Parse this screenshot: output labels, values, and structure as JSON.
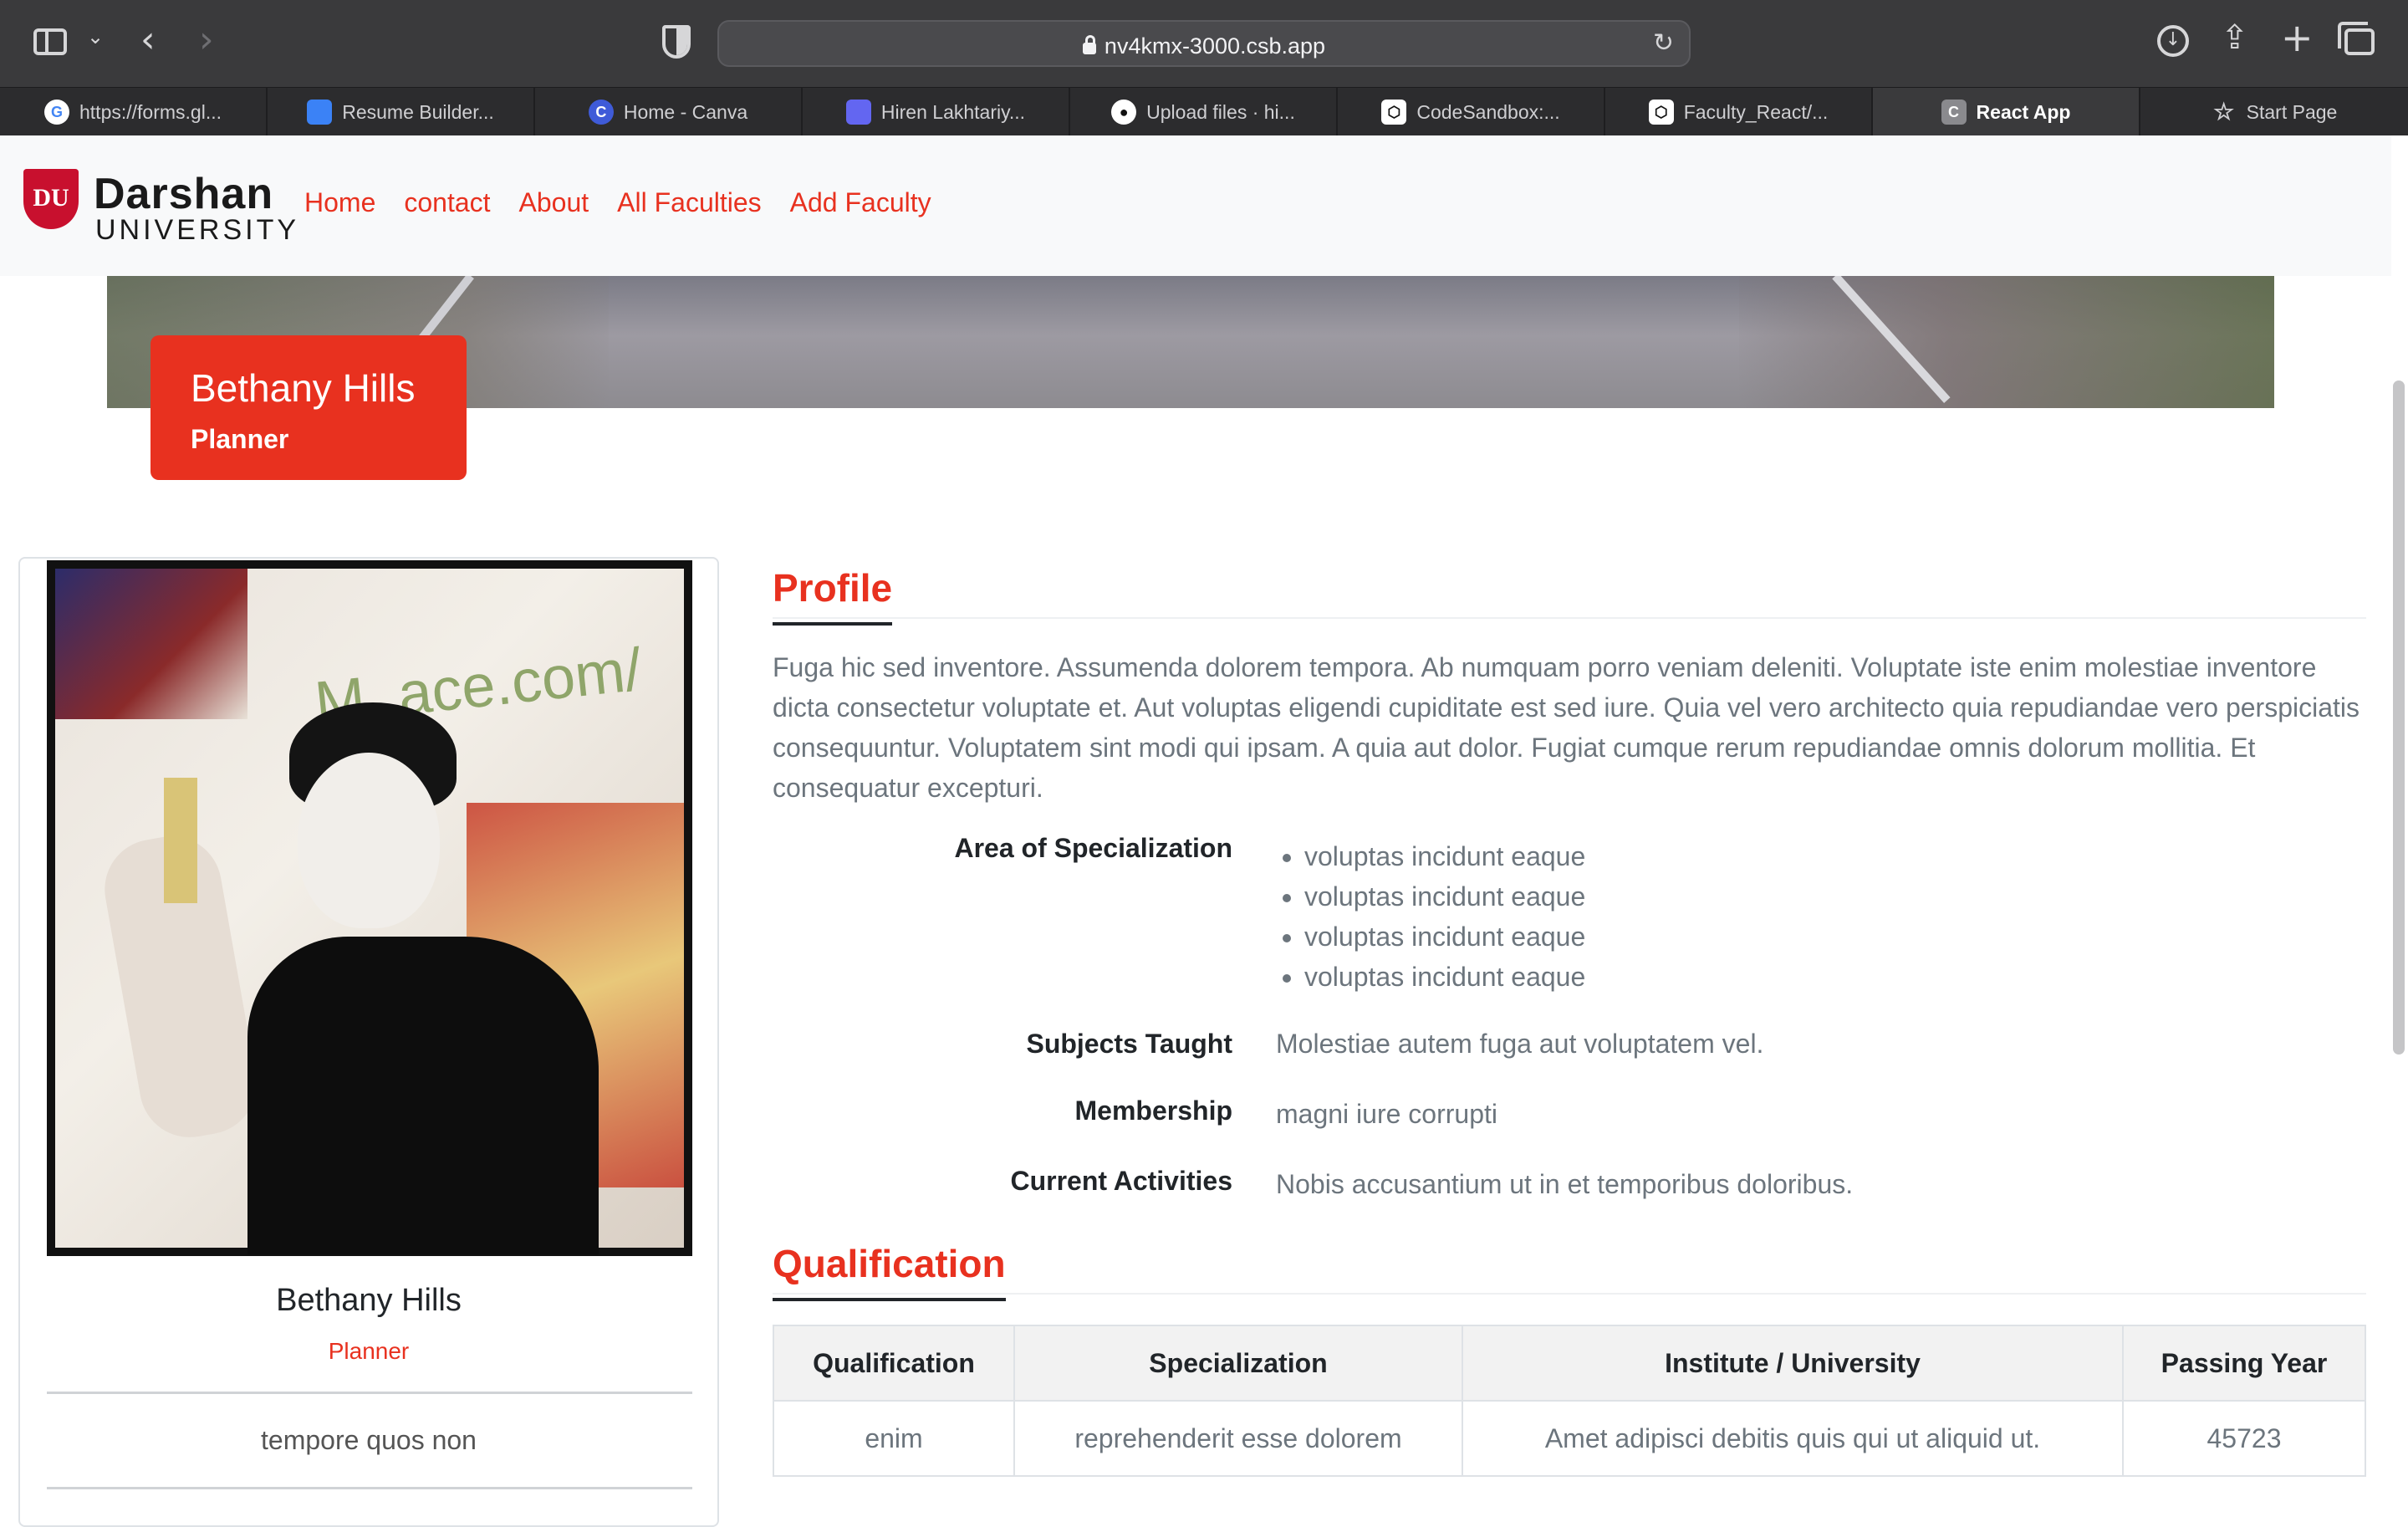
{
  "browser": {
    "url": "nv4kmx-3000.csb.app",
    "tabs": [
      {
        "label": "https://forms.gl...",
        "icon": "google-icon",
        "color": "#ffffff"
      },
      {
        "label": "Resume Builder...",
        "icon": "resume-icon",
        "color": "#3b82f6"
      },
      {
        "label": "Home - Canva",
        "icon": "canva-icon",
        "color": "#3f5bd8"
      },
      {
        "label": "Hiren Lakhtariy...",
        "icon": "profile-icon",
        "color": "#6366f1"
      },
      {
        "label": "Upload files · hi...",
        "icon": "github-icon",
        "color": "#ffffff"
      },
      {
        "label": "CodeSandbox:...",
        "icon": "codesandbox-icon",
        "color": "#ffffff"
      },
      {
        "label": "Faculty_React/...",
        "icon": "codesandbox-icon",
        "color": "#ffffff"
      },
      {
        "label": "React App",
        "icon": "react-app-icon",
        "color": "#8a8a8e",
        "active": true
      },
      {
        "label": "Start Page",
        "icon": "star-icon",
        "color": "#cfcfd2"
      }
    ]
  },
  "navbar": {
    "logo_name": "Darshan",
    "logo_sub": "UNIVERSITY",
    "logo_mark": "DU",
    "links": [
      "Home",
      "contact",
      "About",
      "All Faculties",
      "Add Faculty"
    ]
  },
  "hero": {
    "name": "Bethany Hills",
    "role": "Planner"
  },
  "card": {
    "name": "Bethany Hills",
    "role": "Planner",
    "extra": "tempore quos non"
  },
  "profile": {
    "title": "Profile",
    "text": "Fuga hic sed inventore. Assumenda dolorem tempora. Ab numquam porro veniam deleniti. Voluptate iste enim molestiae inventore dicta consectetur voluptate et. Aut voluptas eligendi cupiditate est sed iure. Quia vel vero architecto quia repudiandae vero perspiciatis consequuntur. Voluptatem sint modi qui ipsam. A quia aut dolor. Fugiat cumque rerum repudiandae omnis dolorum mollitia. Et consequatur excepturi.",
    "specialization_label": "Area of Specialization",
    "specializations": [
      "voluptas incidunt eaque",
      "voluptas incidunt eaque",
      "voluptas incidunt eaque",
      "voluptas incidunt eaque"
    ],
    "subjects_label": "Subjects Taught",
    "subjects": "Molestiae autem fuga aut voluptatem vel.",
    "membership_label": "Membership",
    "membership": "magni iure corrupti",
    "activities_label": "Current Activities",
    "activities": "Nobis accusantium ut in et temporibus doloribus."
  },
  "qualification": {
    "title": "Qualification",
    "headers": [
      "Qualification",
      "Specialization",
      "Institute / University",
      "Passing Year"
    ],
    "rows": [
      [
        "enim",
        "reprehenderit esse dolorem",
        "Amet adipisci debitis quis qui ut aliquid ut.",
        "45723"
      ]
    ]
  }
}
